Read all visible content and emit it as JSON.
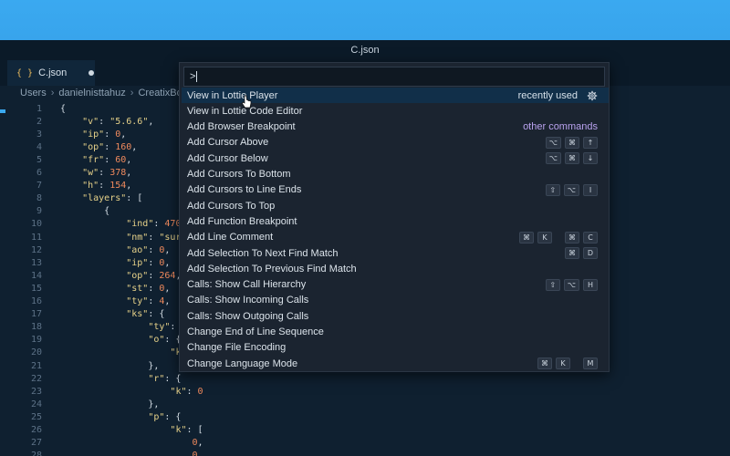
{
  "window": {
    "title": "C.json"
  },
  "tab": {
    "icon": "{ }",
    "label": "C.json",
    "modified": true
  },
  "breadcrumb": [
    "Users",
    "danielnisttahuz",
    "CreatixBox"
  ],
  "editor": {
    "lines": [
      {
        "n": "1",
        "code": [
          [
            "t",
            "{"
          ]
        ]
      },
      {
        "n": "2",
        "code": [
          [
            "t",
            "    "
          ],
          [
            "s",
            "\"v\""
          ],
          [
            "t",
            ": "
          ],
          [
            "s",
            "\"5.6.6\""
          ],
          [
            "t",
            ","
          ]
        ]
      },
      {
        "n": "3",
        "code": [
          [
            "t",
            "    "
          ],
          [
            "s",
            "\"ip\""
          ],
          [
            "t",
            ": "
          ],
          [
            "n",
            "0"
          ],
          [
            "t",
            ","
          ]
        ]
      },
      {
        "n": "4",
        "code": [
          [
            "t",
            "    "
          ],
          [
            "s",
            "\"op\""
          ],
          [
            "t",
            ": "
          ],
          [
            "n",
            "160"
          ],
          [
            "t",
            ","
          ]
        ]
      },
      {
        "n": "5",
        "code": [
          [
            "t",
            "    "
          ],
          [
            "s",
            "\"fr\""
          ],
          [
            "t",
            ": "
          ],
          [
            "n",
            "60"
          ],
          [
            "t",
            ","
          ]
        ]
      },
      {
        "n": "6",
        "code": [
          [
            "t",
            "    "
          ],
          [
            "s",
            "\"w\""
          ],
          [
            "t",
            ": "
          ],
          [
            "n",
            "378"
          ],
          [
            "t",
            ","
          ]
        ]
      },
      {
        "n": "7",
        "code": [
          [
            "t",
            "    "
          ],
          [
            "s",
            "\"h\""
          ],
          [
            "t",
            ": "
          ],
          [
            "n",
            "154"
          ],
          [
            "t",
            ","
          ]
        ]
      },
      {
        "n": "8",
        "code": [
          [
            "t",
            "    "
          ],
          [
            "s",
            "\"layers\""
          ],
          [
            "t",
            ": ["
          ]
        ]
      },
      {
        "n": "9",
        "code": [
          [
            "t",
            "        {"
          ]
        ]
      },
      {
        "n": "10",
        "code": [
          [
            "t",
            "            "
          ],
          [
            "s",
            "\"ind\""
          ],
          [
            "t",
            ": "
          ],
          [
            "n",
            "470"
          ],
          [
            "t",
            ","
          ]
        ]
      },
      {
        "n": "11",
        "code": [
          [
            "t",
            "            "
          ],
          [
            "s",
            "\"nm\""
          ],
          [
            "t",
            ": "
          ],
          [
            "s",
            "\"surf"
          ]
        ]
      },
      {
        "n": "12",
        "code": [
          [
            "t",
            "            "
          ],
          [
            "s",
            "\"ao\""
          ],
          [
            "t",
            ": "
          ],
          [
            "n",
            "0"
          ],
          [
            "t",
            ","
          ]
        ]
      },
      {
        "n": "13",
        "code": [
          [
            "t",
            "            "
          ],
          [
            "s",
            "\"ip\""
          ],
          [
            "t",
            ": "
          ],
          [
            "n",
            "0"
          ],
          [
            "t",
            ","
          ]
        ]
      },
      {
        "n": "14",
        "code": [
          [
            "t",
            "            "
          ],
          [
            "s",
            "\"op\""
          ],
          [
            "t",
            ": "
          ],
          [
            "n",
            "264"
          ],
          [
            "t",
            ","
          ]
        ]
      },
      {
        "n": "15",
        "code": [
          [
            "t",
            "            "
          ],
          [
            "s",
            "\"st\""
          ],
          [
            "t",
            ": "
          ],
          [
            "n",
            "0"
          ],
          [
            "t",
            ","
          ]
        ]
      },
      {
        "n": "16",
        "code": [
          [
            "t",
            "            "
          ],
          [
            "s",
            "\"ty\""
          ],
          [
            "t",
            ": "
          ],
          [
            "n",
            "4"
          ],
          [
            "t",
            ","
          ]
        ]
      },
      {
        "n": "17",
        "code": [
          [
            "t",
            "            "
          ],
          [
            "s",
            "\"ks\""
          ],
          [
            "t",
            ": {"
          ]
        ]
      },
      {
        "n": "18",
        "code": [
          [
            "t",
            "                "
          ],
          [
            "s",
            "\"ty\""
          ],
          [
            "t",
            ": "
          ],
          [
            "s",
            "\""
          ]
        ]
      },
      {
        "n": "19",
        "code": [
          [
            "t",
            "                "
          ],
          [
            "s",
            "\"o\""
          ],
          [
            "t",
            ": {"
          ]
        ]
      },
      {
        "n": "20",
        "code": [
          [
            "t",
            "                    "
          ],
          [
            "s",
            "\"k"
          ]
        ]
      },
      {
        "n": "21",
        "code": [
          [
            "t",
            "                },"
          ]
        ]
      },
      {
        "n": "22",
        "code": [
          [
            "t",
            "                "
          ],
          [
            "s",
            "\"r\""
          ],
          [
            "t",
            ": {"
          ]
        ]
      },
      {
        "n": "23",
        "code": [
          [
            "t",
            "                    "
          ],
          [
            "s",
            "\"k\""
          ],
          [
            "t",
            ": "
          ],
          [
            "n",
            "0"
          ]
        ]
      },
      {
        "n": "24",
        "code": [
          [
            "t",
            "                },"
          ]
        ]
      },
      {
        "n": "25",
        "code": [
          [
            "t",
            "                "
          ],
          [
            "s",
            "\"p\""
          ],
          [
            "t",
            ": {"
          ]
        ]
      },
      {
        "n": "26",
        "code": [
          [
            "t",
            "                    "
          ],
          [
            "s",
            "\"k\""
          ],
          [
            "t",
            ": ["
          ]
        ]
      },
      {
        "n": "27",
        "code": [
          [
            "t",
            "                        "
          ],
          [
            "n",
            "0"
          ],
          [
            "t",
            ","
          ]
        ]
      },
      {
        "n": "28",
        "code": [
          [
            "t",
            "                        "
          ],
          [
            "n",
            "0"
          ],
          [
            "t",
            ","
          ]
        ]
      }
    ]
  },
  "palette": {
    "input_value": ">",
    "items": [
      {
        "label": "View in Lottie Player",
        "selected": true,
        "tag": "recently used",
        "gear": true
      },
      {
        "label": "View in Lottie Code Editor"
      },
      {
        "label": "Add Browser Breakpoint",
        "tag_other": "other commands"
      },
      {
        "label": "Add Cursor Above",
        "keys": [
          [
            "⌥",
            "⌘",
            "↑"
          ]
        ]
      },
      {
        "label": "Add Cursor Below",
        "keys": [
          [
            "⌥",
            "⌘",
            "↓"
          ]
        ]
      },
      {
        "label": "Add Cursors To Bottom"
      },
      {
        "label": "Add Cursors to Line Ends",
        "keys": [
          [
            "⇧",
            "⌥",
            "I"
          ]
        ]
      },
      {
        "label": "Add Cursors To Top"
      },
      {
        "label": "Add Function Breakpoint"
      },
      {
        "label": "Add Line Comment",
        "keys": [
          [
            "⌘",
            "K"
          ],
          [
            "⌘",
            "C"
          ]
        ]
      },
      {
        "label": "Add Selection To Next Find Match",
        "keys": [
          [
            "⌘",
            "D"
          ]
        ]
      },
      {
        "label": "Add Selection To Previous Find Match"
      },
      {
        "label": "Calls: Show Call Hierarchy",
        "keys": [
          [
            "⇧",
            "⌥",
            "H"
          ]
        ]
      },
      {
        "label": "Calls: Show Incoming Calls"
      },
      {
        "label": "Calls: Show Outgoing Calls"
      },
      {
        "label": "Change End of Line Sequence"
      },
      {
        "label": "Change File Encoding"
      },
      {
        "label": "Change Language Mode",
        "keys": [
          [
            "⌘",
            "K"
          ],
          [
            "M"
          ]
        ]
      }
    ]
  },
  "colors": {
    "accent_blue": "#3aa9f0",
    "editor_bg": "#0f2030",
    "palette_bg": "#1b2430",
    "selected_row": "#112f49",
    "other_commands": "#b9a2ee",
    "string": "#e6d189",
    "number": "#f08a5d"
  }
}
